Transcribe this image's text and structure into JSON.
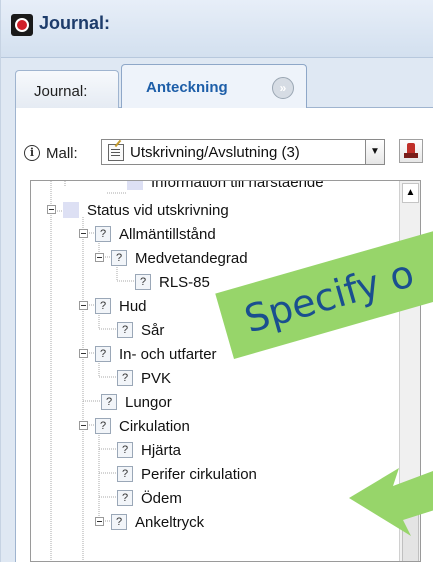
{
  "window": {
    "title": "Journal:"
  },
  "tabs": [
    {
      "label": "Journal:"
    },
    {
      "label": "Anteckning",
      "close_glyph": "»"
    }
  ],
  "mall": {
    "label": "Mall:",
    "value": "Utskrivning/Avslutning (3)",
    "dropdown_glyph": "▼"
  },
  "tree": {
    "nodes": [
      {
        "label": "Information till närstående",
        "kind": "square"
      },
      {
        "label": "Status vid utskrivning",
        "kind": "square"
      },
      {
        "label": "Allmäntillstånd",
        "kind": "question"
      },
      {
        "label": "Medvetandegrad",
        "kind": "question"
      },
      {
        "label": "RLS-85",
        "kind": "question"
      },
      {
        "label": "Hud",
        "kind": "question"
      },
      {
        "label": "Sår",
        "kind": "question"
      },
      {
        "label": "In- och utfarter",
        "kind": "question"
      },
      {
        "label": "PVK",
        "kind": "question"
      },
      {
        "label": "Lungor",
        "kind": "question"
      },
      {
        "label": "Cirkulation",
        "kind": "question"
      },
      {
        "label": "Hjärta",
        "kind": "question"
      },
      {
        "label": "Perifer cirkulation",
        "kind": "question"
      },
      {
        "label": "Ödem",
        "kind": "question"
      },
      {
        "label": "Ankeltryck",
        "kind": "question"
      }
    ],
    "question_glyph": "?",
    "scroll_up_glyph": "▲"
  },
  "callout": {
    "text": "Specify o",
    "color": "#97d56a",
    "text_color": "#1a4f8f"
  },
  "colors": {
    "accent": "#1d5ea8",
    "title": "#1d3c6b",
    "arrow": "#97d56a"
  }
}
